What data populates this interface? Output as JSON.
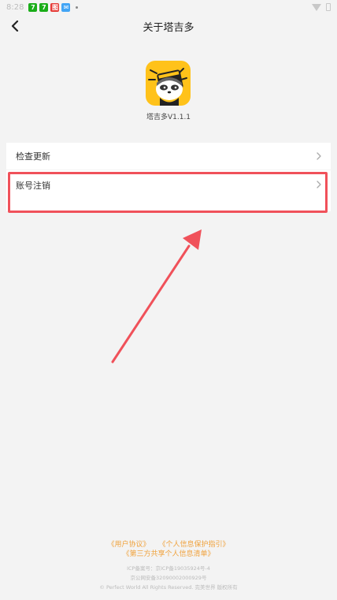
{
  "status_bar": {
    "time": "8:28",
    "icons": [
      {
        "name": "app-icon-1",
        "color": "#1aad19",
        "glyph": "7"
      },
      {
        "name": "app-icon-2",
        "color": "#1aad19",
        "glyph": "7"
      },
      {
        "name": "app-icon-3",
        "color": "#e53935",
        "glyph": "图"
      },
      {
        "name": "app-icon-4",
        "color": "#42a5f5",
        "glyph": "✉"
      }
    ]
  },
  "header": {
    "title": "关于塔吉多"
  },
  "app": {
    "version": "塔吉多V1.1.1",
    "brand_color": "#ffc21a"
  },
  "settings": {
    "check_update": "检查更新",
    "account_cancel": "账号注销"
  },
  "annotation": {
    "highlight_color": "#f0515a"
  },
  "footer": {
    "user_agreement": "《用户协议》",
    "privacy_guide": "《个人信息保护指引》",
    "third_party_list": "《第三方共享个人信息清单》",
    "icp": "ICP备案号：京ICP备19035924号-4",
    "security": "京公网安备32090002000929号",
    "copyright": "© Perfect World All Rights Reserved. 完美世界 版权所有"
  }
}
